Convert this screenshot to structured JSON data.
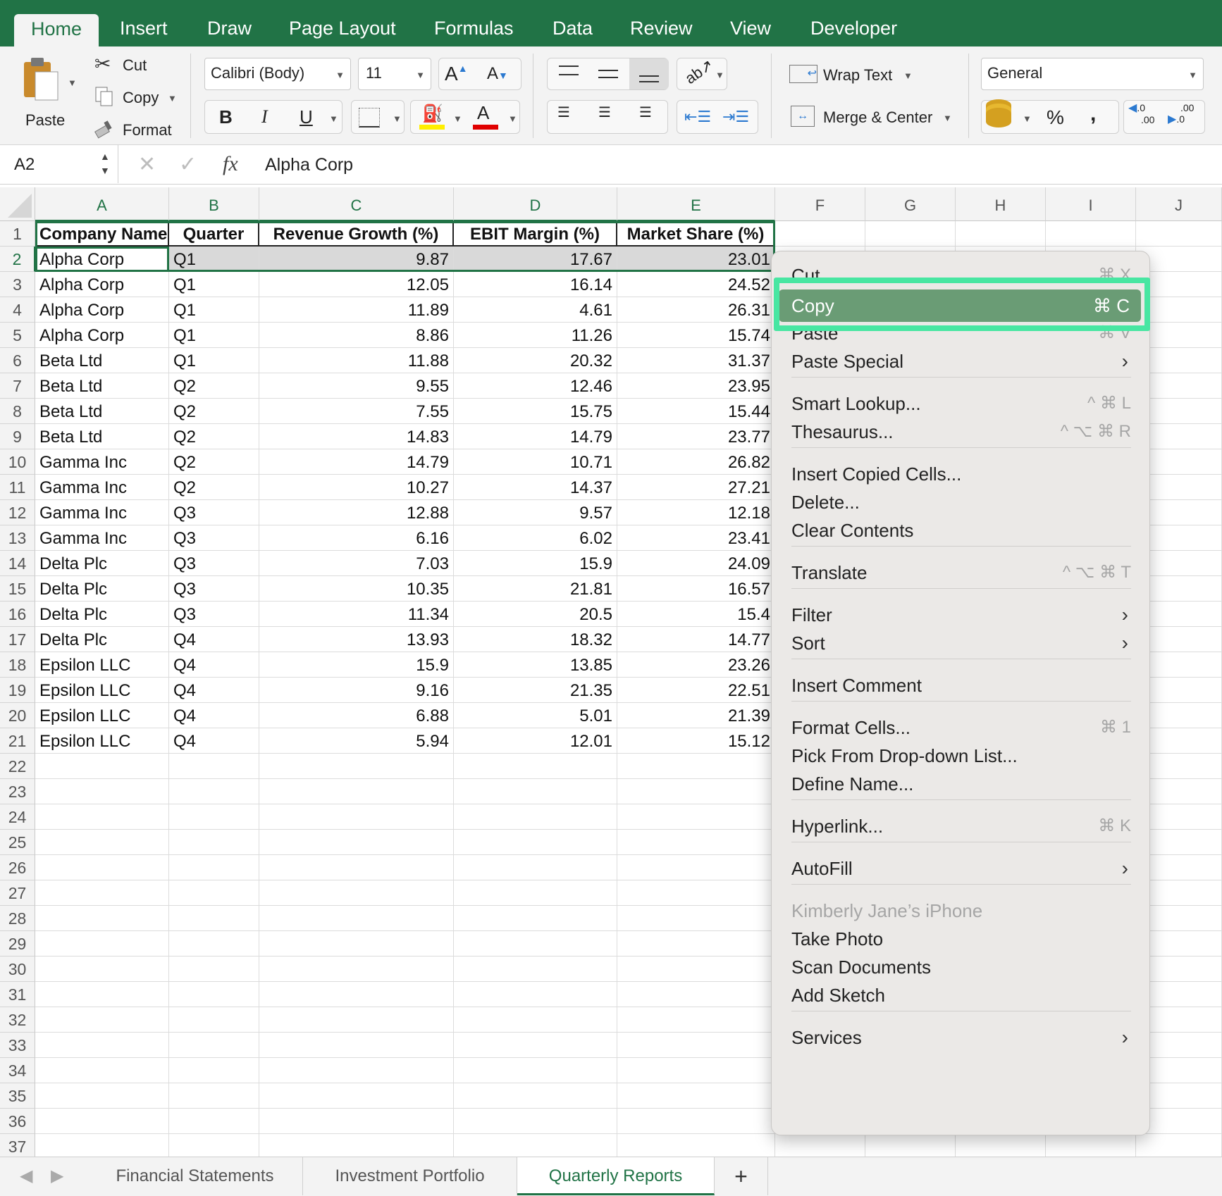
{
  "ribbon_tabs": [
    {
      "label": "Home",
      "active": true
    },
    {
      "label": "Insert"
    },
    {
      "label": "Draw"
    },
    {
      "label": "Page Layout"
    },
    {
      "label": "Formulas"
    },
    {
      "label": "Data"
    },
    {
      "label": "Review"
    },
    {
      "label": "View"
    },
    {
      "label": "Developer"
    }
  ],
  "clipboard": {
    "paste_label": "Paste",
    "cut_label": "Cut",
    "copy_label": "Copy",
    "format_label": "Format"
  },
  "font": {
    "name": "Calibri (Body)",
    "size": "11",
    "grow_label": "A",
    "shrink_label": "A",
    "bold": "B",
    "italic": "I",
    "underline": "U",
    "font_color_label": "A"
  },
  "alignment": {
    "wrap_text_label": "Wrap Text",
    "merge_center_label": "Merge & Center"
  },
  "number": {
    "format": "General",
    "percent": "%",
    "comma": ",",
    "inc_decimal_top": ".0",
    "inc_decimal_bottom": ".00",
    "dec_decimal_top": ".00",
    "dec_decimal_bottom": ".0"
  },
  "formula_bar": {
    "name_box": "A2",
    "fx": "fx",
    "formula": "Alpha Corp"
  },
  "columns": [
    "A",
    "B",
    "C",
    "D",
    "E",
    "F",
    "G",
    "H",
    "I",
    "J"
  ],
  "row_numbers": [
    "1",
    "2",
    "3",
    "4",
    "5",
    "6",
    "7",
    "8",
    "9",
    "10",
    "11",
    "12",
    "13",
    "14",
    "15",
    "16",
    "17",
    "18",
    "19",
    "20",
    "21",
    "22",
    "23",
    "24",
    "25",
    "26",
    "27",
    "28",
    "29",
    "30",
    "31",
    "32",
    "33",
    "34",
    "35",
    "36",
    "37"
  ],
  "table": {
    "headers": [
      "Company Name",
      "Quarter",
      "Revenue Growth (%)",
      "EBIT Margin (%)",
      "Market Share (%)"
    ],
    "rows": [
      [
        "Alpha Corp",
        "Q1",
        "9.87",
        "17.67",
        "23.01"
      ],
      [
        "Alpha Corp",
        "Q1",
        "12.05",
        "16.14",
        "24.52"
      ],
      [
        "Alpha Corp",
        "Q1",
        "11.89",
        "4.61",
        "26.31"
      ],
      [
        "Alpha Corp",
        "Q1",
        "8.86",
        "11.26",
        "15.74"
      ],
      [
        "Beta Ltd",
        "Q1",
        "11.88",
        "20.32",
        "31.37"
      ],
      [
        "Beta Ltd",
        "Q2",
        "9.55",
        "12.46",
        "23.95"
      ],
      [
        "Beta Ltd",
        "Q2",
        "7.55",
        "15.75",
        "15.44"
      ],
      [
        "Beta Ltd",
        "Q2",
        "14.83",
        "14.79",
        "23.77"
      ],
      [
        "Gamma Inc",
        "Q2",
        "14.79",
        "10.71",
        "26.82"
      ],
      [
        "Gamma Inc",
        "Q2",
        "10.27",
        "14.37",
        "27.21"
      ],
      [
        "Gamma Inc",
        "Q3",
        "12.88",
        "9.57",
        "12.18"
      ],
      [
        "Gamma Inc",
        "Q3",
        "6.16",
        "6.02",
        "23.41"
      ],
      [
        "Delta Plc",
        "Q3",
        "7.03",
        "15.9",
        "24.09"
      ],
      [
        "Delta Plc",
        "Q3",
        "10.35",
        "21.81",
        "16.57"
      ],
      [
        "Delta Plc",
        "Q3",
        "11.34",
        "20.5",
        "15.4"
      ],
      [
        "Delta Plc",
        "Q4",
        "13.93",
        "18.32",
        "14.77"
      ],
      [
        "Epsilon LLC",
        "Q4",
        "15.9",
        "13.85",
        "23.26"
      ],
      [
        "Epsilon LLC",
        "Q4",
        "9.16",
        "21.35",
        "22.51"
      ],
      [
        "Epsilon LLC",
        "Q4",
        "6.88",
        "5.01",
        "21.39"
      ],
      [
        "Epsilon LLC",
        "Q4",
        "5.94",
        "12.01",
        "15.12"
      ]
    ]
  },
  "context_menu": {
    "items": [
      {
        "label": "Cut",
        "shortcut": "⌘ X"
      },
      {
        "label": "Copy",
        "shortcut": "⌘ C",
        "highlighted": true
      },
      {
        "label": "Paste",
        "shortcut": "⌘ V"
      },
      {
        "label": "Paste Special",
        "submenu": true
      },
      {
        "label": "Smart Lookup...",
        "shortcut": "^ ⌘ L"
      },
      {
        "label": "Thesaurus...",
        "shortcut": "^ ⌥ ⌘ R"
      },
      {
        "label": "Insert Copied Cells..."
      },
      {
        "label": "Delete..."
      },
      {
        "label": "Clear Contents"
      },
      {
        "label": "Translate",
        "shortcut": "^ ⌥ ⌘ T"
      },
      {
        "label": "Filter",
        "submenu": true
      },
      {
        "label": "Sort",
        "submenu": true
      },
      {
        "label": "Insert Comment"
      },
      {
        "label": "Format Cells...",
        "shortcut": "⌘ 1"
      },
      {
        "label": "Pick From Drop-down List..."
      },
      {
        "label": "Define Name..."
      },
      {
        "label": "Hyperlink...",
        "shortcut": "⌘ K"
      },
      {
        "label": "AutoFill",
        "submenu": true
      },
      {
        "label": "Kimberly Jane’s iPhone",
        "disabled": true
      },
      {
        "label": "Take Photo"
      },
      {
        "label": "Scan Documents"
      },
      {
        "label": "Add Sketch"
      },
      {
        "label": "Services",
        "submenu": true
      }
    ],
    "submenu_arrow": "›"
  },
  "sheet_tabs": [
    {
      "label": "Financial Statements"
    },
    {
      "label": "Investment Portfolio"
    },
    {
      "label": "Quarterly Reports",
      "active": true
    }
  ],
  "add_sheet_label": "+",
  "colors": {
    "accent": "#217346",
    "highlight_ring": "#48e6a2",
    "menu_highlight": "#6a9c75"
  }
}
